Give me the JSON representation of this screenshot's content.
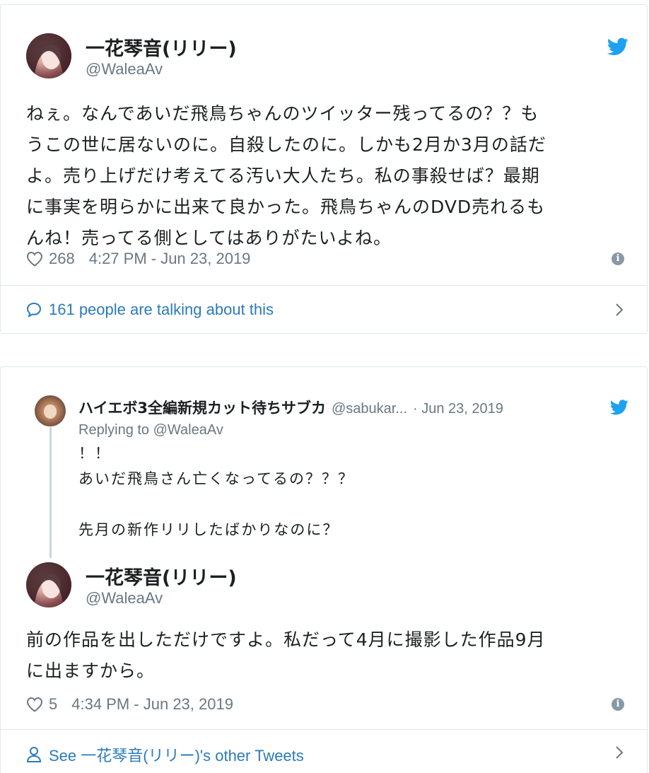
{
  "tweet1": {
    "author_name": "一花琴音(リリー)",
    "author_handle": "@WaleaAv",
    "text_lines": [
      "ねぇ。なんであいだ飛鳥ちゃんのツイッター残ってるの？？も",
      "うこの世に居ないのに。自殺したのに。しかも2月か3月の話だ",
      "よ。売り上げだけ考えてる汚い大人たち。私の事殺せば？最期",
      "に事実を明らかに出来て良かった。飛鳥ちゃんのDVD売れるも",
      "んね！売ってる側としてはありがたいよね。"
    ],
    "likes": "268",
    "timestamp": "4:27 PM - Jun 23, 2019",
    "footer_link": "161 people are talking about this"
  },
  "tweet2": {
    "parent": {
      "author_name": "ハイエボ3全編新規カット待ちサブカ",
      "author_handle": "@sabukar...",
      "date": "· Jun 23, 2019",
      "replying_to": "Replying to @WaleaAv",
      "text_lines": [
        "！！",
        "あいだ飛鳥さん亡くなってるの？？？",
        "",
        "先月の新作リリしたばかりなのに？"
      ]
    },
    "author_name": "一花琴音(リリー)",
    "author_handle": "@WaleaAv",
    "text_lines": [
      "前の作品を出しただけですよ。私だって4月に撮影した作品9月",
      "に出ますから。"
    ],
    "likes": "5",
    "timestamp": "4:34 PM - Jun 23, 2019",
    "footer_link": "See 一花琴音(リリー)'s other Tweets"
  },
  "colors": {
    "twitter_blue": "#1da1f2",
    "link_blue": "#2b7bb9",
    "meta_gray": "#697882",
    "border": "#e1e8ed"
  },
  "icons": [
    "twitter-bird-icon",
    "heart-icon",
    "info-icon",
    "speech-bubble-icon",
    "chevron-right-icon",
    "person-icon"
  ]
}
